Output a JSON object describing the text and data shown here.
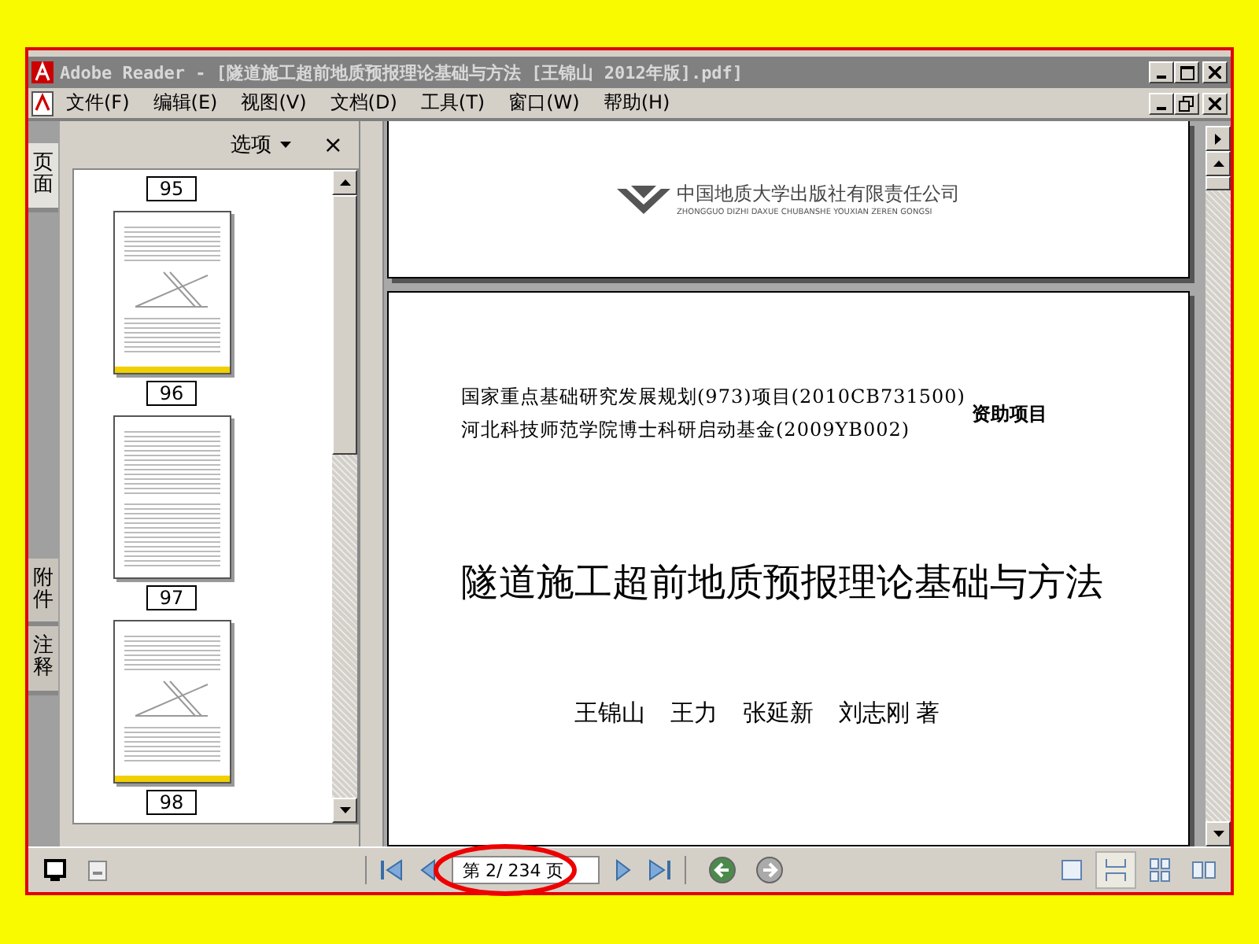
{
  "window": {
    "title": "Adobe Reader - [隧道施工超前地质预报理论基础与方法 [王锦山 2012年版].pdf]"
  },
  "menu": [
    "文件(F)",
    "编辑(E)",
    "视图(V)",
    "文档(D)",
    "工具(T)",
    "窗口(W)",
    "帮助(H)"
  ],
  "side_tabs": [
    {
      "label": "页面",
      "selected": true
    },
    {
      "label": "附件",
      "selected": false
    },
    {
      "label": "注释",
      "selected": false
    }
  ],
  "panel": {
    "options": "选项",
    "close": "×"
  },
  "thumbnails": [
    {
      "page": "95",
      "kind": "cut"
    },
    {
      "page": "96",
      "kind": "figure",
      "highlighted": true
    },
    {
      "page": "97",
      "kind": "text",
      "highlighted": false
    },
    {
      "page": "98",
      "kind": "figure",
      "highlighted": true
    }
  ],
  "document": {
    "publisher": "中国地质大学出版社有限责任公司",
    "publisher_roman": "ZHONGGUO DIZHI DAXUE CHUBANSHE YOUXIAN ZEREN GONGSI",
    "funding": [
      "国家重点基础研究发展规划(973)项目(2010CB731500)",
      "河北科技师范学院博士科研启动基金(2009YB002)"
    ],
    "funding_suffix": "资助项目",
    "title": "隧道施工超前地质预报理论基础与方法",
    "authors": [
      "王锦山",
      "王力",
      "张延新",
      "刘志刚"
    ],
    "author_role": "著"
  },
  "pager": {
    "value": "第 2/ 234 页"
  },
  "history": [
    {
      "kind": "back",
      "disabled": false
    },
    {
      "kind": "forward",
      "disabled": true
    }
  ],
  "view_buttons": [
    {
      "kind": "single",
      "selected": false
    },
    {
      "kind": "continuous",
      "selected": true
    },
    {
      "kind": "continuous-facing",
      "selected": false
    },
    {
      "kind": "facing",
      "selected": false
    }
  ]
}
